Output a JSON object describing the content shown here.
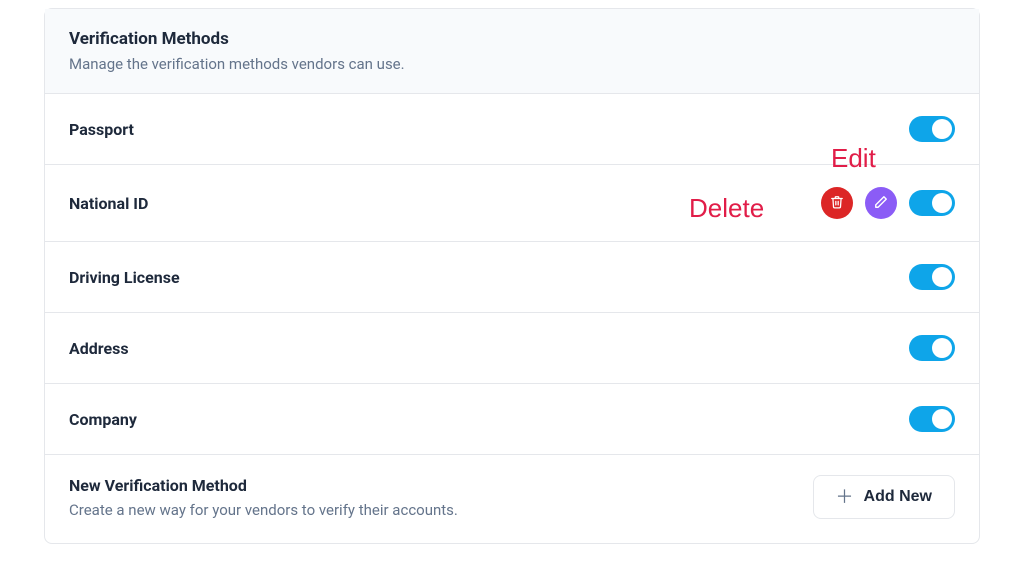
{
  "header": {
    "title": "Verification Methods",
    "subtitle": "Manage the verification methods vendors can use."
  },
  "methods": [
    {
      "label": "Passport",
      "enabled": true,
      "showActions": false
    },
    {
      "label": "National ID",
      "enabled": true,
      "showActions": true
    },
    {
      "label": "Driving License",
      "enabled": true,
      "showActions": false
    },
    {
      "label": "Address",
      "enabled": true,
      "showActions": false
    },
    {
      "label": "Company",
      "enabled": true,
      "showActions": false
    }
  ],
  "annotations": {
    "delete": "Delete",
    "edit": "Edit"
  },
  "footer": {
    "title": "New Verification Method",
    "subtitle": "Create a new way for your vendors to verify their accounts.",
    "buttonLabel": "Add New"
  },
  "colors": {
    "toggleOn": "#0ea5e9",
    "deleteBtn": "#dc2626",
    "editBtn": "#8b5cf6",
    "annotation": "#e11d48"
  }
}
